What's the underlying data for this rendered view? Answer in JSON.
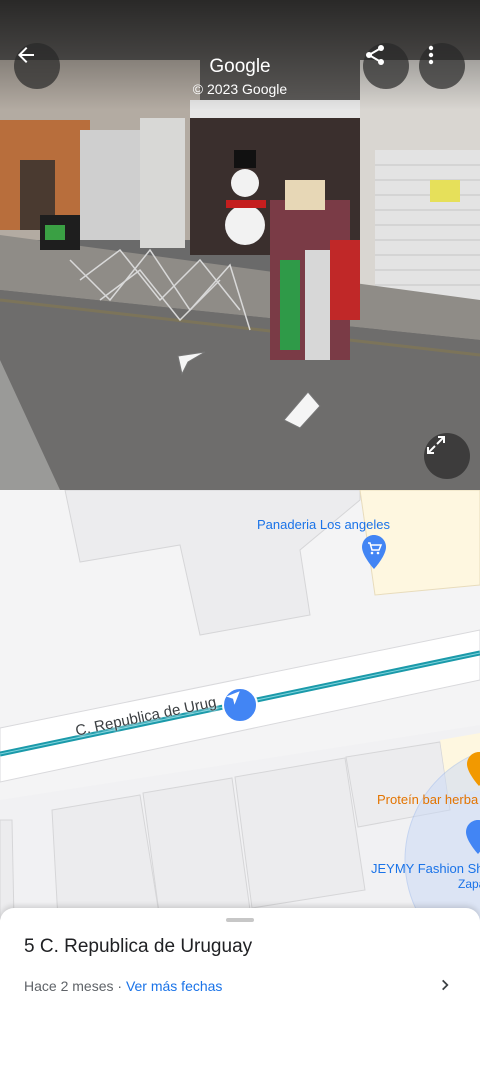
{
  "streetview": {
    "brand": "Google",
    "copyright": "© 2023 Google",
    "back_icon": "arrow-left-icon",
    "share_icon": "share-icon",
    "menu_icon": "more-vert-icon",
    "expand_icon": "expand-icon"
  },
  "map": {
    "street_name": "C. Republica de Uruguay",
    "street_label_visible": "C. Republica de Urug",
    "pois": [
      {
        "name": "Panaderia Los angeles",
        "color": "#1a73e8",
        "icon": "shopping-cart-icon"
      },
      {
        "name": "Proteín bar herba",
        "color": "#e37400",
        "icon": "food-icon"
      },
      {
        "name": "JEYMY Fashion Sh",
        "color": "#1a73e8",
        "icon": "shopping-icon"
      },
      {
        "name": "Zapa",
        "color": "#1a73e8"
      }
    ],
    "colors": {
      "route": "#1b9aaa",
      "marker": "#4285f4"
    }
  },
  "sheet": {
    "address": "5 C. Republica de Uruguay",
    "time_ago": "Hace 2 meses",
    "separator": " · ",
    "more_dates": "Ver más fechas"
  }
}
